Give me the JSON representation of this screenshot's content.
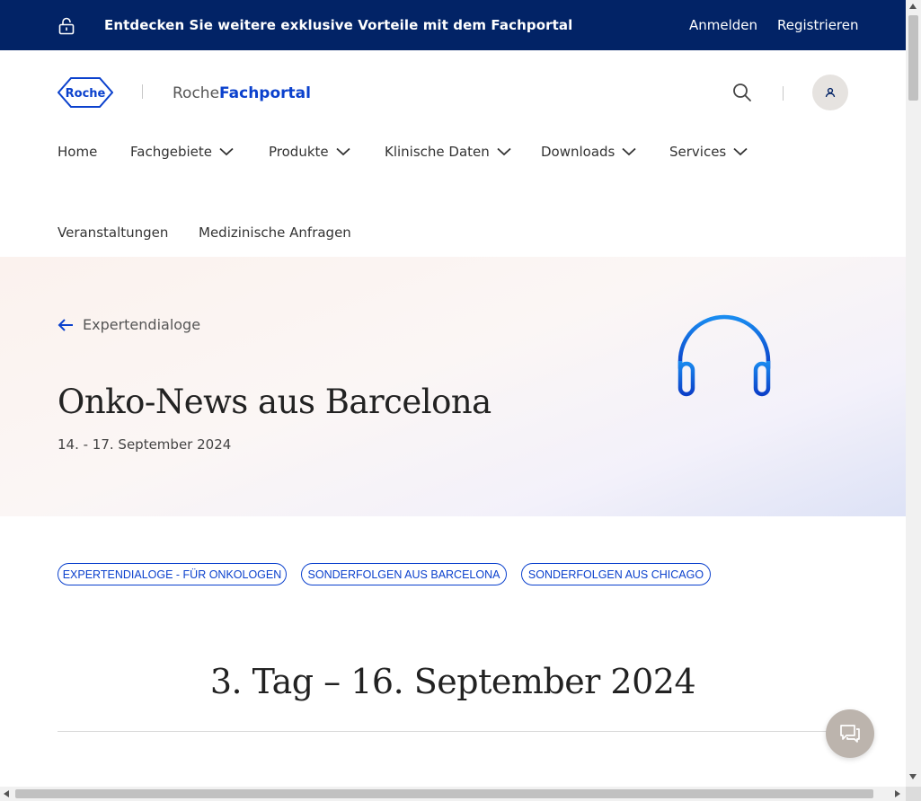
{
  "promo": {
    "message": "Entdecken Sie weitere exklusive Vorteile mit dem Fachportal",
    "login": "Anmelden",
    "register": "Registrieren",
    "background": "#022366"
  },
  "brand": {
    "logo_text": "Roche",
    "portal_prefix": "Roche",
    "portal_name": "Fachportal",
    "accent": "#0b41cd"
  },
  "nav": {
    "items": [
      {
        "label": "Home",
        "dropdown": false
      },
      {
        "label": "Fachgebiete",
        "dropdown": true
      },
      {
        "label": "Produkte",
        "dropdown": true
      },
      {
        "label": "Klinische Daten",
        "dropdown": true
      },
      {
        "label": "Downloads",
        "dropdown": true
      },
      {
        "label": "Services",
        "dropdown": true
      },
      {
        "label": "Veranstaltungen",
        "dropdown": false
      },
      {
        "label": "Medizinische Anfragen",
        "dropdown": false
      }
    ]
  },
  "hero": {
    "back_label": "Expertendialoge",
    "title": "Onko-News aus Barcelona",
    "date": "14. - 17. September 2024",
    "icon": "headphones-icon"
  },
  "tags": [
    "EXPERTENDIALOGE - FÜR ONKOLOGEN",
    "SONDERFOLGEN AUS BARCELONA",
    "SONDERFOLGEN AUS CHICAGO"
  ],
  "section": {
    "day_title": "3. Tag – 16. September 2024"
  }
}
